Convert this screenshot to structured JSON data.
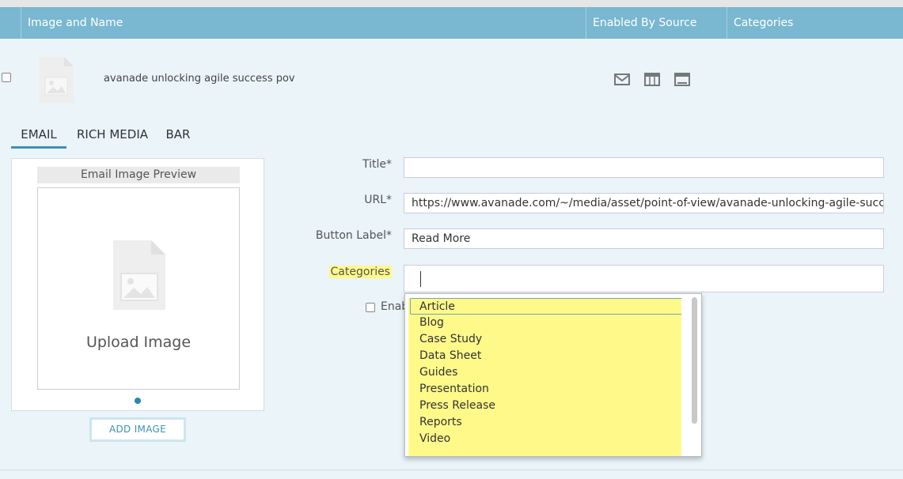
{
  "header": {
    "col_image_name": "Image and Name",
    "col_enabled_by_source": "Enabled By Source",
    "col_categories": "Categories"
  },
  "row": {
    "name": "avanade unlocking agile success pov",
    "icons": [
      "envelope-icon",
      "rich-media-icon",
      "bar-icon"
    ]
  },
  "tabs": [
    {
      "label": "EMAIL",
      "active": true
    },
    {
      "label": "RICH MEDIA",
      "active": false
    },
    {
      "label": "BAR",
      "active": false
    }
  ],
  "preview": {
    "title": "Email Image Preview",
    "upload_text": "Upload Image",
    "add_image_label": "ADD IMAGE"
  },
  "form": {
    "title_label": "Title*",
    "title_value": "",
    "url_label": "URL*",
    "url_value": "https://www.avanade.com/~/media/asset/point-of-view/avanade-unlocking-agile-success-pov.p",
    "button_label_label": "Button Label*",
    "button_label_value": "Read More",
    "categories_label": "Categories",
    "categories_value": "",
    "enable_label": "Enab"
  },
  "dropdown": {
    "items": [
      "Article",
      "Blog",
      "Case Study",
      "Data Sheet",
      "Guides",
      "Presentation",
      "Press Release",
      "Reports",
      "Video"
    ]
  },
  "colors": {
    "header_bg": "#7ab7d0",
    "accent": "#3d93b5",
    "highlight": "#fff98a",
    "page_bg": "#eaf4f9"
  }
}
